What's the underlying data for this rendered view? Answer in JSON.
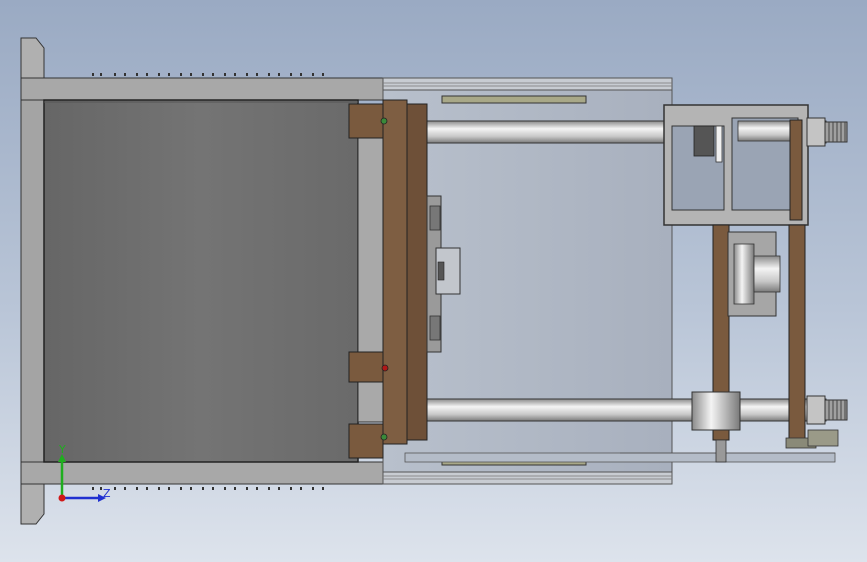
{
  "view": {
    "background_top": "#9aaac3",
    "background_bottom": "#dde3ec"
  },
  "triad": {
    "y_label": "Y",
    "z_label": "Z",
    "y_color": "#1fae1f",
    "z_color": "#2030d0",
    "x_color": "#d01818"
  },
  "colors": {
    "frame_gray": "#9c9c9c",
    "chamber_gray": "#6e6e6e",
    "platen_brown": "#7a5a3e",
    "rod_light": "#e8e8e8",
    "rod_dark": "#8a8a8a",
    "guide_olive": "#9a9a78"
  }
}
